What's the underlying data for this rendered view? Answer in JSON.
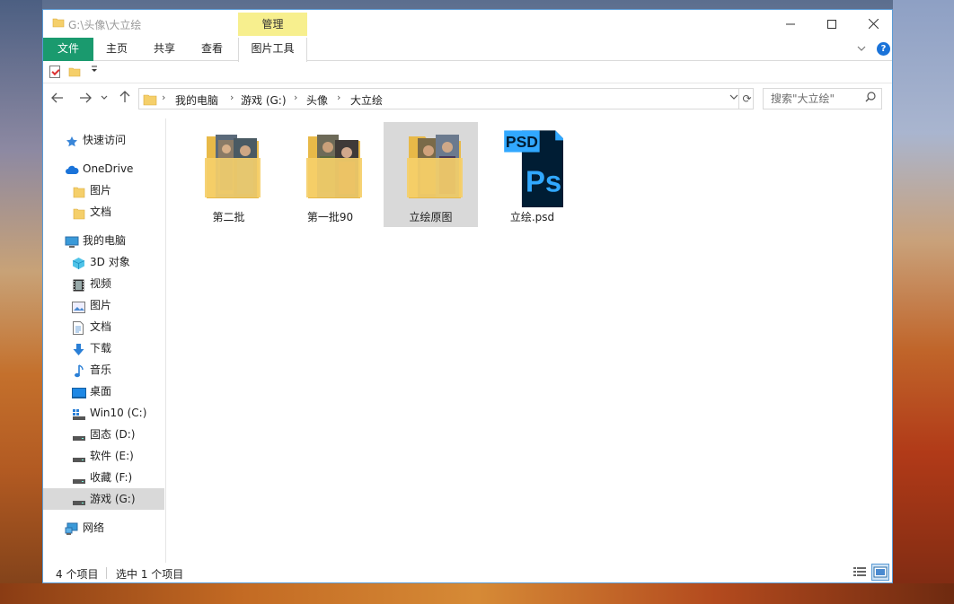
{
  "window": {
    "title": "G:\\头像\\大立绘",
    "contextual_tab_group": "管理",
    "controls": {
      "minimize": "—",
      "maximize": "☐",
      "close": "✕"
    }
  },
  "ribbon": {
    "tabs": [
      {
        "label": "文件",
        "active_file": true
      },
      {
        "label": "主页"
      },
      {
        "label": "共享"
      },
      {
        "label": "查看"
      },
      {
        "label": "图片工具"
      }
    ],
    "help": "?"
  },
  "address": {
    "crumbs": [
      "我的电脑",
      "游戏 (G:)",
      "头像",
      "大立绘"
    ]
  },
  "search": {
    "placeholder": "搜索\"大立绘\""
  },
  "sidebar": {
    "items": [
      {
        "label": "快速访问",
        "icon": "star-icon"
      },
      {
        "label": "OneDrive",
        "icon": "cloud-icon"
      },
      {
        "label": "图片",
        "icon": "folder-icon"
      },
      {
        "label": "文档",
        "icon": "folder-icon"
      },
      {
        "label": "我的电脑",
        "icon": "computer-icon"
      },
      {
        "label": "3D 对象",
        "icon": "cube-icon"
      },
      {
        "label": "视频",
        "icon": "video-icon"
      },
      {
        "label": "图片",
        "icon": "pictures-icon"
      },
      {
        "label": "文档",
        "icon": "document-icon"
      },
      {
        "label": "下载",
        "icon": "download-arrow-icon"
      },
      {
        "label": "音乐",
        "icon": "music-note-icon"
      },
      {
        "label": "桌面",
        "icon": "desktop-icon"
      },
      {
        "label": "Win10 (C:)",
        "icon": "system-drive-icon"
      },
      {
        "label": "固态 (D:)",
        "icon": "drive-icon"
      },
      {
        "label": "软件 (E:)",
        "icon": "drive-icon"
      },
      {
        "label": "收藏 (F:)",
        "icon": "drive-icon"
      },
      {
        "label": "游戏 (G:)",
        "icon": "drive-icon",
        "selected": true
      },
      {
        "label": "网络",
        "icon": "network-icon"
      }
    ]
  },
  "files": [
    {
      "name": "第二批",
      "type": "folder"
    },
    {
      "name": "第一批90",
      "type": "folder"
    },
    {
      "name": "立绘原图",
      "type": "folder",
      "selected": true
    },
    {
      "name": "立绘.psd",
      "type": "psd",
      "badge": "PSD",
      "logo": "Ps"
    }
  ],
  "status": {
    "count": "4 个项目",
    "selection": "选中 1 个项目"
  },
  "colors": {
    "file_tab": "#1a9a6e",
    "manage_tab": "#f7ef8e",
    "selection": "#d9d9d9",
    "accent": "#1a73d9",
    "folder": "#f5cf6a",
    "ps_dark": "#001d34",
    "ps_blue": "#31a8ff"
  }
}
